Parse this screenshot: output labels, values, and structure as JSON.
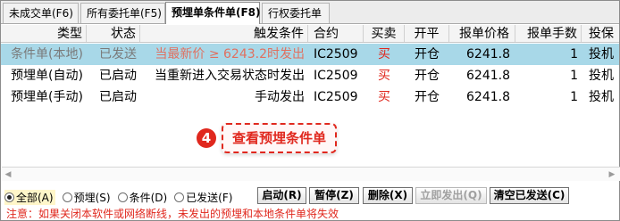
{
  "tabs": [
    {
      "label": "未成交单(F6)",
      "active": false
    },
    {
      "label": "所有委托单(F5)",
      "active": false
    },
    {
      "label": "预埋单条件单(F8)",
      "active": true
    },
    {
      "label": "行权委托单",
      "active": false
    }
  ],
  "table": {
    "headers": [
      "类型",
      "状态",
      "触发条件",
      "合约",
      "买卖",
      "开平",
      "报单价格",
      "报单手数",
      "投保"
    ],
    "rows": [
      {
        "type": "条件单(本地)",
        "status": "已发送",
        "trigger": "当最新价 ≥ 6243.2时发出",
        "contract": "IC2509",
        "side": "买",
        "offset": "开仓",
        "price": "6241.8",
        "qty": "1",
        "hedge": "投机"
      },
      {
        "type": "预埋单(自动)",
        "status": "已启动",
        "trigger": "当重新进入交易状态时发出",
        "contract": "IC2509",
        "side": "买",
        "offset": "开仓",
        "price": "6241.8",
        "qty": "1",
        "hedge": "投机"
      },
      {
        "type": "预埋单(手动)",
        "status": "已启动",
        "trigger": "手动发出",
        "contract": "IC2509",
        "side": "买",
        "offset": "开仓",
        "price": "6241.8",
        "qty": "1",
        "hedge": "投机"
      }
    ]
  },
  "callout": {
    "badge": "4",
    "text": "查看预埋条件单"
  },
  "filters": [
    {
      "label": "全部(A)",
      "checked": true
    },
    {
      "label": "预埋(S)",
      "checked": false
    },
    {
      "label": "条件(D)",
      "checked": false
    },
    {
      "label": "已发送(F)",
      "checked": false
    }
  ],
  "buttons": {
    "start": "启动(R)",
    "pause": "暂停(Z)",
    "delete": "删除(X)",
    "send_now": "立即发出(Q)",
    "clear_sent": "清空已发送(C)"
  },
  "notice": "注意：如果关闭本软件或网络断线，未发出的预埋和本地条件单将失效",
  "colors": {
    "accent_red": "#e0281e",
    "selected_row": "#a8d8e8"
  }
}
